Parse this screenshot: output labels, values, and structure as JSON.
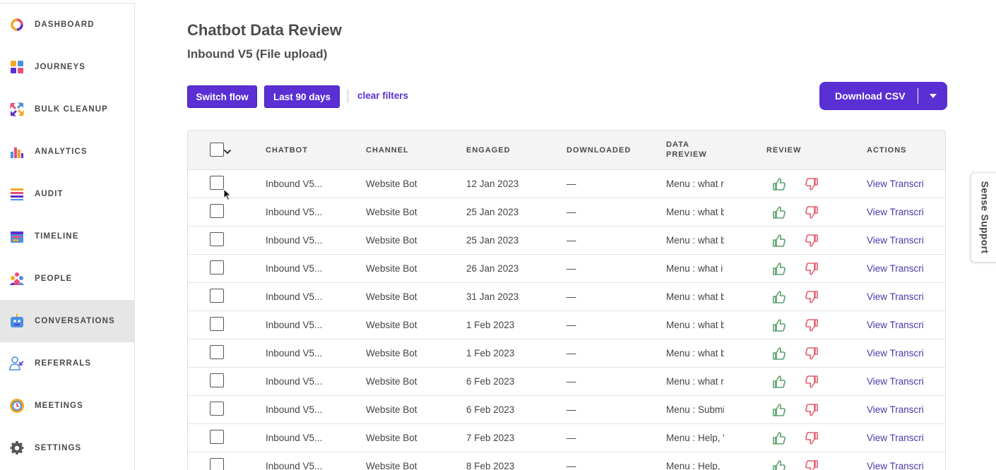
{
  "sidebar": {
    "items": [
      {
        "label": "DASHBOARD",
        "icon": "dashboard-ring-icon"
      },
      {
        "label": "JOURNEYS",
        "icon": "journeys-grid-icon"
      },
      {
        "label": "BULK CLEANUP",
        "icon": "bulk-cleanup-arrows-icon"
      },
      {
        "label": "ANALYTICS",
        "icon": "analytics-bars-icon"
      },
      {
        "label": "AUDIT",
        "icon": "audit-list-icon"
      },
      {
        "label": "TIMELINE",
        "icon": "timeline-calendar-icon"
      },
      {
        "label": "PEOPLE",
        "icon": "people-group-icon"
      },
      {
        "label": "CONVERSATIONS",
        "icon": "conversations-bot-icon",
        "active": true
      },
      {
        "label": "REFERRALS",
        "icon": "referrals-user-icon"
      },
      {
        "label": "MEETINGS",
        "icon": "meetings-clock-icon"
      },
      {
        "label": "SETTINGS",
        "icon": "settings-gear-icon"
      }
    ]
  },
  "page": {
    "title": "Chatbot Data Review",
    "subtitle": "Inbound V5 (File upload)"
  },
  "filters": {
    "switch_flow": "Switch flow",
    "date_range": "Last 90 days",
    "clear": "clear filters"
  },
  "download": {
    "label": "Download CSV"
  },
  "table": {
    "columns": [
      "CHATBOT",
      "CHANNEL",
      "ENGAGED",
      "DOWNLOADED",
      "DATA PREVIEW",
      "REVIEW",
      "ACTIONS"
    ],
    "rows": [
      {
        "chatbot": "Inbound V5...",
        "channel": "Website Bot",
        "engaged": "12 Jan 2023",
        "downloaded": "—",
        "preview": "Menu : what r",
        "action": "View Transcri"
      },
      {
        "chatbot": "Inbound V5...",
        "channel": "Website Bot",
        "engaged": "25 Jan 2023",
        "downloaded": "—",
        "preview": "Menu : what b",
        "action": "View Transcri"
      },
      {
        "chatbot": "Inbound V5...",
        "channel": "Website Bot",
        "engaged": "25 Jan 2023",
        "downloaded": "—",
        "preview": "Menu : what b",
        "action": "View Transcri"
      },
      {
        "chatbot": "Inbound V5...",
        "channel": "Website Bot",
        "engaged": "26 Jan 2023",
        "downloaded": "—",
        "preview": "Menu : what i",
        "action": "View Transcri"
      },
      {
        "chatbot": "Inbound V5...",
        "channel": "Website Bot",
        "engaged": "31 Jan 2023",
        "downloaded": "—",
        "preview": "Menu : what b",
        "action": "View Transcri"
      },
      {
        "chatbot": "Inbound V5...",
        "channel": "Website Bot",
        "engaged": "1 Feb 2023",
        "downloaded": "—",
        "preview": "Menu : what b",
        "action": "View Transcri"
      },
      {
        "chatbot": "Inbound V5...",
        "channel": "Website Bot",
        "engaged": "1 Feb 2023",
        "downloaded": "—",
        "preview": "Menu : what b",
        "action": "View Transcri"
      },
      {
        "chatbot": "Inbound V5...",
        "channel": "Website Bot",
        "engaged": "6 Feb 2023",
        "downloaded": "—",
        "preview": "Menu : what r",
        "action": "View Transcri"
      },
      {
        "chatbot": "Inbound V5...",
        "channel": "Website Bot",
        "engaged": "6 Feb 2023",
        "downloaded": "—",
        "preview": "Menu : Submi",
        "action": "View Transcri"
      },
      {
        "chatbot": "Inbound V5...",
        "channel": "Website Bot",
        "engaged": "7 Feb 2023",
        "downloaded": "—",
        "preview": "Menu : Help, '",
        "action": "View Transcri"
      },
      {
        "chatbot": "Inbound V5...",
        "channel": "Website Bot",
        "engaged": "8 Feb 2023",
        "downloaded": "—",
        "preview": "Menu : Help,",
        "action": "View Transcri"
      }
    ]
  },
  "support": {
    "label": "Sense Support"
  },
  "colors": {
    "accent": "#5a2fd4",
    "thumb_up": "#5aa06a",
    "thumb_down": "#e0606e",
    "link": "#4a3aa8"
  }
}
